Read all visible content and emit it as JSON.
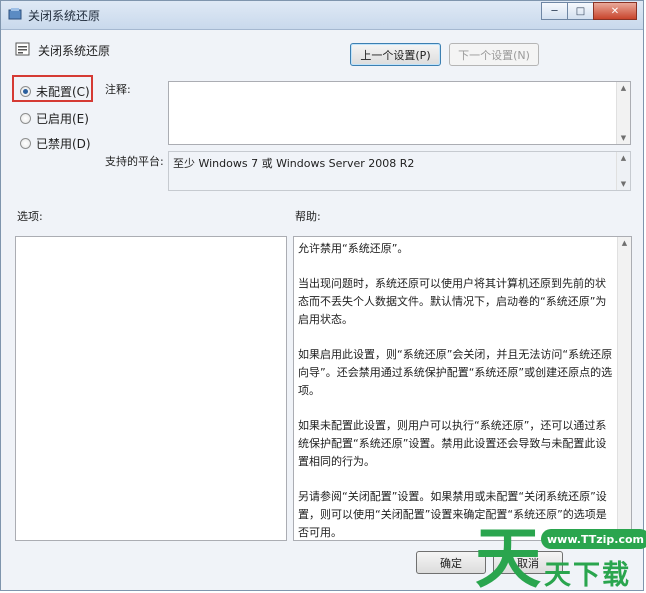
{
  "window": {
    "title": "关闭系统还原"
  },
  "header": {
    "policy_name": "关闭系统还原",
    "prev_label": "上一个设置(P)",
    "next_label": "下一个设置(N)"
  },
  "options_radio": [
    {
      "label": "未配置(C)",
      "checked": true
    },
    {
      "label": "已启用(E)",
      "checked": false
    },
    {
      "label": "已禁用(D)",
      "checked": false
    }
  ],
  "comment": {
    "label": "注释:",
    "value": ""
  },
  "platform": {
    "label": "支持的平台:",
    "value": "至少 Windows 7 或 Windows Server 2008 R2"
  },
  "options_section": {
    "label": "选项:"
  },
  "help_section": {
    "label": "帮助:",
    "paragraphs": [
      "允许禁用“系统还原”。",
      "当出现问题时，系统还原可以使用户将其计算机还原到先前的状态而不丢失个人数据文件。默认情况下，启动卷的“系统还原”为启用状态。",
      "如果启用此设置，则“系统还原”会关闭，并且无法访问“系统还原向导”。还会禁用通过系统保护配置“系统还原”或创建还原点的选项。",
      "如果未配置此设置，则用户可以执行“系统还原”，还可以通过系统保护配置“系统还原”设置。禁用此设置还会导致与未配置此设置相同的行为。",
      "另请参阅“关闭配置”设置。如果禁用或未配置“关闭系统还原”设置，则可以使用“关闭配置”设置来确定配置“系统还原”的选项是否可用。"
    ]
  },
  "footer": {
    "ok_label": "确定",
    "cancel_label": "取消"
  },
  "watermark": {
    "url": "www.TTzip.com",
    "text": "天下载",
    "big_char": "天"
  },
  "colors": {
    "accent": "#2aa54e",
    "highlight": "#d53a34"
  }
}
